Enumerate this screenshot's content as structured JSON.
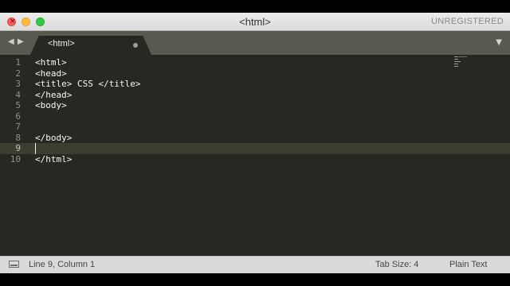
{
  "window": {
    "title": "<html>",
    "registration": "UNREGISTERED"
  },
  "tab": {
    "label": "<html>"
  },
  "editor": {
    "lines": [
      {
        "number": "1",
        "text": "<html>"
      },
      {
        "number": "2",
        "text": "<head>"
      },
      {
        "number": "3",
        "text": "<title> CSS </title>"
      },
      {
        "number": "4",
        "text": "</head>"
      },
      {
        "number": "5",
        "text": "<body>"
      },
      {
        "number": "6",
        "text": ""
      },
      {
        "number": "7",
        "text": ""
      },
      {
        "number": "8",
        "text": "</body>"
      },
      {
        "number": "9",
        "text": ""
      },
      {
        "number": "10",
        "text": "</html>"
      }
    ],
    "active_line": 9
  },
  "statusbar": {
    "position": "Line 9, Column 1",
    "tab_size": "Tab Size: 4",
    "syntax": "Plain Text"
  },
  "colors": {
    "background": "#272822",
    "text": "#f8f8f2",
    "gutter_text": "#8f908a",
    "tabbar": "#58594f",
    "statusbar": "#dadada"
  }
}
